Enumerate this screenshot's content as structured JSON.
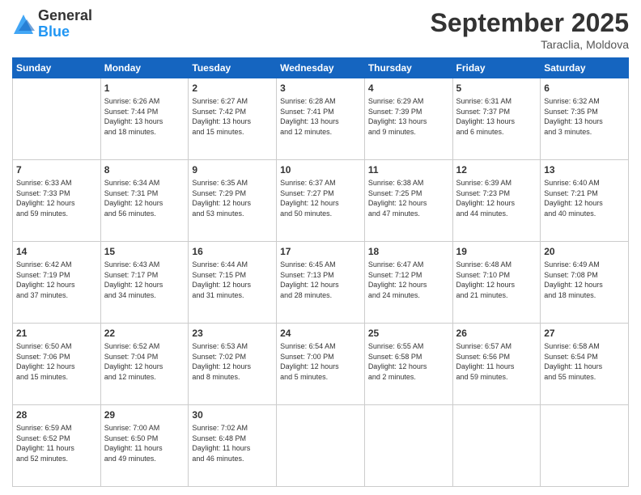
{
  "header": {
    "logo_general": "General",
    "logo_blue": "Blue",
    "month": "September 2025",
    "location": "Taraclia, Moldova"
  },
  "weekdays": [
    "Sunday",
    "Monday",
    "Tuesday",
    "Wednesday",
    "Thursday",
    "Friday",
    "Saturday"
  ],
  "weeks": [
    [
      {
        "day": "",
        "content": ""
      },
      {
        "day": "1",
        "content": "Sunrise: 6:26 AM\nSunset: 7:44 PM\nDaylight: 13 hours\nand 18 minutes."
      },
      {
        "day": "2",
        "content": "Sunrise: 6:27 AM\nSunset: 7:42 PM\nDaylight: 13 hours\nand 15 minutes."
      },
      {
        "day": "3",
        "content": "Sunrise: 6:28 AM\nSunset: 7:41 PM\nDaylight: 13 hours\nand 12 minutes."
      },
      {
        "day": "4",
        "content": "Sunrise: 6:29 AM\nSunset: 7:39 PM\nDaylight: 13 hours\nand 9 minutes."
      },
      {
        "day": "5",
        "content": "Sunrise: 6:31 AM\nSunset: 7:37 PM\nDaylight: 13 hours\nand 6 minutes."
      },
      {
        "day": "6",
        "content": "Sunrise: 6:32 AM\nSunset: 7:35 PM\nDaylight: 13 hours\nand 3 minutes."
      }
    ],
    [
      {
        "day": "7",
        "content": "Sunrise: 6:33 AM\nSunset: 7:33 PM\nDaylight: 12 hours\nand 59 minutes."
      },
      {
        "day": "8",
        "content": "Sunrise: 6:34 AM\nSunset: 7:31 PM\nDaylight: 12 hours\nand 56 minutes."
      },
      {
        "day": "9",
        "content": "Sunrise: 6:35 AM\nSunset: 7:29 PM\nDaylight: 12 hours\nand 53 minutes."
      },
      {
        "day": "10",
        "content": "Sunrise: 6:37 AM\nSunset: 7:27 PM\nDaylight: 12 hours\nand 50 minutes."
      },
      {
        "day": "11",
        "content": "Sunrise: 6:38 AM\nSunset: 7:25 PM\nDaylight: 12 hours\nand 47 minutes."
      },
      {
        "day": "12",
        "content": "Sunrise: 6:39 AM\nSunset: 7:23 PM\nDaylight: 12 hours\nand 44 minutes."
      },
      {
        "day": "13",
        "content": "Sunrise: 6:40 AM\nSunset: 7:21 PM\nDaylight: 12 hours\nand 40 minutes."
      }
    ],
    [
      {
        "day": "14",
        "content": "Sunrise: 6:42 AM\nSunset: 7:19 PM\nDaylight: 12 hours\nand 37 minutes."
      },
      {
        "day": "15",
        "content": "Sunrise: 6:43 AM\nSunset: 7:17 PM\nDaylight: 12 hours\nand 34 minutes."
      },
      {
        "day": "16",
        "content": "Sunrise: 6:44 AM\nSunset: 7:15 PM\nDaylight: 12 hours\nand 31 minutes."
      },
      {
        "day": "17",
        "content": "Sunrise: 6:45 AM\nSunset: 7:13 PM\nDaylight: 12 hours\nand 28 minutes."
      },
      {
        "day": "18",
        "content": "Sunrise: 6:47 AM\nSunset: 7:12 PM\nDaylight: 12 hours\nand 24 minutes."
      },
      {
        "day": "19",
        "content": "Sunrise: 6:48 AM\nSunset: 7:10 PM\nDaylight: 12 hours\nand 21 minutes."
      },
      {
        "day": "20",
        "content": "Sunrise: 6:49 AM\nSunset: 7:08 PM\nDaylight: 12 hours\nand 18 minutes."
      }
    ],
    [
      {
        "day": "21",
        "content": "Sunrise: 6:50 AM\nSunset: 7:06 PM\nDaylight: 12 hours\nand 15 minutes."
      },
      {
        "day": "22",
        "content": "Sunrise: 6:52 AM\nSunset: 7:04 PM\nDaylight: 12 hours\nand 12 minutes."
      },
      {
        "day": "23",
        "content": "Sunrise: 6:53 AM\nSunset: 7:02 PM\nDaylight: 12 hours\nand 8 minutes."
      },
      {
        "day": "24",
        "content": "Sunrise: 6:54 AM\nSunset: 7:00 PM\nDaylight: 12 hours\nand 5 minutes."
      },
      {
        "day": "25",
        "content": "Sunrise: 6:55 AM\nSunset: 6:58 PM\nDaylight: 12 hours\nand 2 minutes."
      },
      {
        "day": "26",
        "content": "Sunrise: 6:57 AM\nSunset: 6:56 PM\nDaylight: 11 hours\nand 59 minutes."
      },
      {
        "day": "27",
        "content": "Sunrise: 6:58 AM\nSunset: 6:54 PM\nDaylight: 11 hours\nand 55 minutes."
      }
    ],
    [
      {
        "day": "28",
        "content": "Sunrise: 6:59 AM\nSunset: 6:52 PM\nDaylight: 11 hours\nand 52 minutes."
      },
      {
        "day": "29",
        "content": "Sunrise: 7:00 AM\nSunset: 6:50 PM\nDaylight: 11 hours\nand 49 minutes."
      },
      {
        "day": "30",
        "content": "Sunrise: 7:02 AM\nSunset: 6:48 PM\nDaylight: 11 hours\nand 46 minutes."
      },
      {
        "day": "",
        "content": ""
      },
      {
        "day": "",
        "content": ""
      },
      {
        "day": "",
        "content": ""
      },
      {
        "day": "",
        "content": ""
      }
    ]
  ]
}
